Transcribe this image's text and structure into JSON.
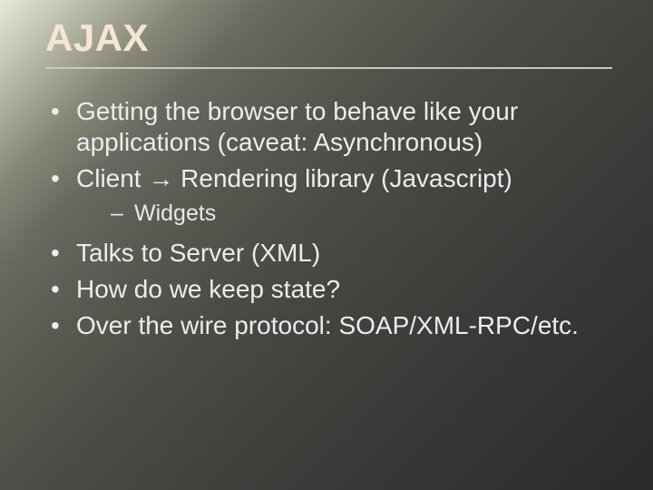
{
  "slide": {
    "title": "AJAX",
    "bullets": [
      {
        "text": "Getting the browser to behave like your applications (caveat: Asynchronous)"
      },
      {
        "text_pre": "Client ",
        "arrow": "→",
        "text_post": " Rendering library (Javascript)",
        "sub": [
          {
            "text": "Widgets"
          }
        ]
      },
      {
        "text": "Talks to Server (XML)"
      },
      {
        "text": "How do we keep state?"
      },
      {
        "text": "Over the wire protocol: SOAP/XML-RPC/etc."
      }
    ]
  }
}
